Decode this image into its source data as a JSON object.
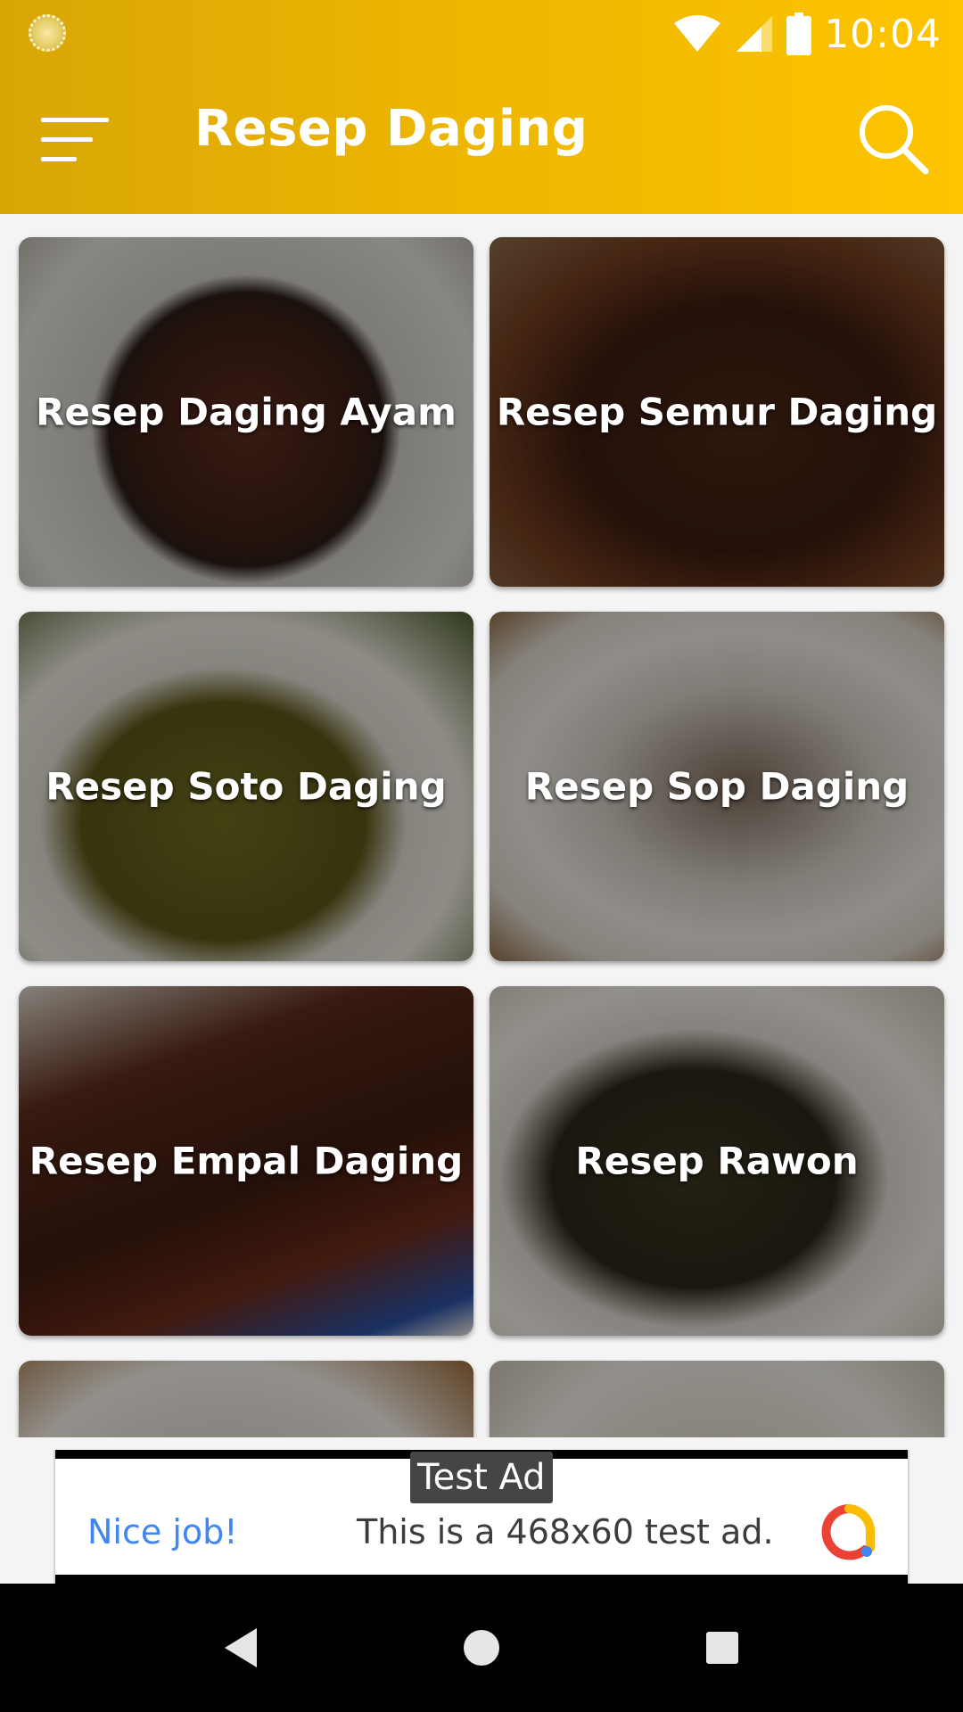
{
  "status_bar": {
    "time": "10:04",
    "icons": [
      "wifi-icon",
      "signal-icon",
      "battery-icon"
    ]
  },
  "toolbar": {
    "title": "Resep Daging",
    "menu_icon": "hamburger-menu-icon",
    "search_icon": "search-icon"
  },
  "recipes": [
    {
      "label": "Resep Daging Ayam"
    },
    {
      "label": "Resep Semur Daging"
    },
    {
      "label": "Resep Soto Daging"
    },
    {
      "label": "Resep Sop Daging"
    },
    {
      "label": "Resep Empal Daging"
    },
    {
      "label": "Resep Rawon"
    },
    {
      "label": ""
    },
    {
      "label": ""
    }
  ],
  "ad": {
    "badge": "Test Ad",
    "left_text": "Nice job!",
    "text": "This is a 468x60 test ad."
  },
  "nav": {
    "buttons": [
      "back-icon",
      "home-icon",
      "recents-icon"
    ]
  },
  "colors": {
    "app_bar_start": "#d9a606",
    "app_bar_end": "#fdc400",
    "ad_link": "#4285f4"
  }
}
